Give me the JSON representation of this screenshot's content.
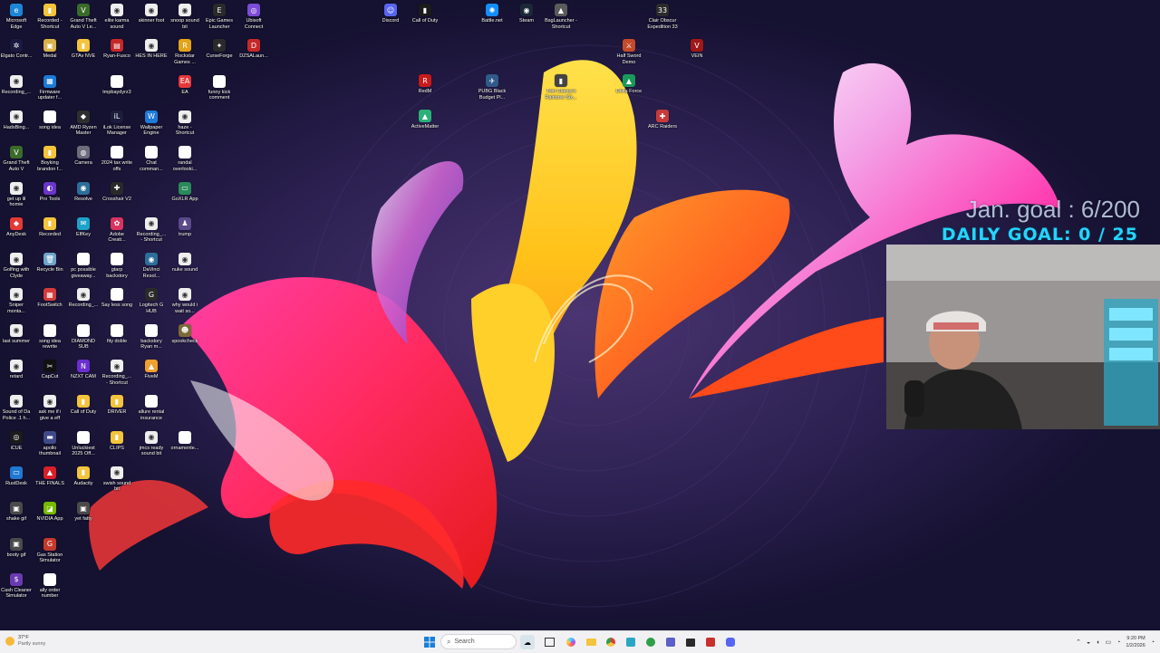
{
  "overlay": {
    "monthly_goal": "Jan. goal : 6/200",
    "daily_goal": "DAILY GOAL: 0 / 25"
  },
  "desktop_icons": [
    {
      "label": "Microsoft Edge",
      "color": "#1c86d6",
      "glyph": "e"
    },
    {
      "label": "Recorded - Shortcut",
      "color": "#f3c43c",
      "glyph": "▮"
    },
    {
      "label": "Grand Theft Auto V Le...",
      "color": "#3a6b2a",
      "glyph": "V"
    },
    {
      "label": "elite karma sound",
      "color": "#eeeeee",
      "glyph": "◉"
    },
    {
      "label": "skinner foot",
      "color": "#eeeeee",
      "glyph": "◉"
    },
    {
      "label": "snoop sound bit",
      "color": "#eeeeee",
      "glyph": "◉"
    },
    {
      "label": "Epic Games Launcher",
      "color": "#2a2a2a",
      "glyph": "E"
    },
    {
      "label": "Ubisoft Connect",
      "color": "#7c4cd6",
      "glyph": "◎"
    },
    {
      "label": "Elgato Contr...",
      "color": "#1a1a40",
      "glyph": "✲"
    },
    {
      "label": "Medal",
      "color": "#d8b24a",
      "glyph": "▣"
    },
    {
      "label": "GTAv NVE",
      "color": "#f3c43c",
      "glyph": "▮"
    },
    {
      "label": "Ryan-Fusco",
      "color": "#c62828",
      "glyph": "▤"
    },
    {
      "label": "HES IN HERE",
      "color": "#eeeeee",
      "glyph": "◉"
    },
    {
      "label": "Rockstar Games ...",
      "color": "#e3a41a",
      "glyph": "R"
    },
    {
      "label": "CurseForge",
      "color": "#2a2a2a",
      "glyph": "✦"
    },
    {
      "label": "DZSALaun...",
      "color": "#c62828",
      "glyph": "D"
    },
    {
      "label": "Recording_...",
      "color": "#eeeeee",
      "glyph": "◉"
    },
    {
      "label": "Firmware updater f...",
      "color": "#1b7bd6",
      "glyph": "▦"
    },
    {
      "label": "",
      "color": "transparent",
      "glyph": ""
    },
    {
      "label": "tmpbaydyrz3",
      "color": "#ffffff",
      "glyph": ""
    },
    {
      "label": "",
      "color": "transparent",
      "glyph": ""
    },
    {
      "label": "EA",
      "color": "#e5383b",
      "glyph": "EA"
    },
    {
      "label": "funny kick comment",
      "color": "#ffffff",
      "glyph": ""
    },
    {
      "label": "",
      "color": "transparent",
      "glyph": ""
    },
    {
      "label": "HadsBing...",
      "color": "#eeeeee",
      "glyph": "◉"
    },
    {
      "label": "song idea",
      "color": "#ffffff",
      "glyph": ""
    },
    {
      "label": "AMD Ryzen Master",
      "color": "#2f2f2f",
      "glyph": "◆"
    },
    {
      "label": "iLok License Manager",
      "color": "#1c1c3c",
      "glyph": "iL"
    },
    {
      "label": "Wallpaper Engine",
      "color": "#1f7ad8",
      "glyph": "W"
    },
    {
      "label": "haze - Shortcut",
      "color": "#eeeeee",
      "glyph": "◉"
    },
    {
      "label": "",
      "color": "transparent",
      "glyph": ""
    },
    {
      "label": "",
      "color": "transparent",
      "glyph": ""
    },
    {
      "label": "Grand Theft Auto V",
      "color": "#3a6b2a",
      "glyph": "V"
    },
    {
      "label": "Boyking brandon f...",
      "color": "#f3c43c",
      "glyph": "▮"
    },
    {
      "label": "Camera",
      "color": "#6c6c7c",
      "glyph": "◍"
    },
    {
      "label": "2024 tax write offs",
      "color": "#ffffff",
      "glyph": ""
    },
    {
      "label": "Chat comman...",
      "color": "#ffffff",
      "glyph": ""
    },
    {
      "label": "randal overlooki...",
      "color": "#ffffff",
      "glyph": ""
    },
    {
      "label": "",
      "color": "transparent",
      "glyph": ""
    },
    {
      "label": "",
      "color": "transparent",
      "glyph": ""
    },
    {
      "label": "get up lil homie",
      "color": "#eeeeee",
      "glyph": "◉"
    },
    {
      "label": "Pro Tools",
      "color": "#6a36c9",
      "glyph": "◐"
    },
    {
      "label": "Resolve",
      "color": "#2c6e99",
      "glyph": "◉"
    },
    {
      "label": "Crosshair V2",
      "color": "#2a2a2a",
      "glyph": "✚"
    },
    {
      "label": "",
      "color": "transparent",
      "glyph": ""
    },
    {
      "label": "GoXLR App",
      "color": "#2a8a5a",
      "glyph": "▭"
    },
    {
      "label": "",
      "color": "transparent",
      "glyph": ""
    },
    {
      "label": "",
      "color": "transparent",
      "glyph": ""
    },
    {
      "label": "AnyDesk",
      "color": "#e53935",
      "glyph": "◆"
    },
    {
      "label": "Recorded",
      "color": "#f3c43c",
      "glyph": "▮"
    },
    {
      "label": "ElfKey",
      "color": "#1ea2c9",
      "glyph": "✉"
    },
    {
      "label": "Adobe Creati...",
      "color": "#d8345f",
      "glyph": "✿"
    },
    {
      "label": "Recording_... - Shortcut",
      "color": "#eeeeee",
      "glyph": "◉"
    },
    {
      "label": "trump",
      "color": "#5a4a8a",
      "glyph": "♟"
    },
    {
      "label": "",
      "color": "transparent",
      "glyph": ""
    },
    {
      "label": "",
      "color": "transparent",
      "glyph": ""
    },
    {
      "label": "Golfing with Clyde",
      "color": "#eeeeee",
      "glyph": "◉"
    },
    {
      "label": "Recycle Bin",
      "color": "#6fa4c9",
      "glyph": "🗑"
    },
    {
      "label": "pc possible giveaway...",
      "color": "#ffffff",
      "glyph": ""
    },
    {
      "label": "gtarp backstory",
      "color": "#ffffff",
      "glyph": ""
    },
    {
      "label": "DaVinci Resol...",
      "color": "#2c6e99",
      "glyph": "◉"
    },
    {
      "label": "nuke sound",
      "color": "#eeeeee",
      "glyph": "◉"
    },
    {
      "label": "",
      "color": "transparent",
      "glyph": ""
    },
    {
      "label": "",
      "color": "transparent",
      "glyph": ""
    },
    {
      "label": "Sniper monta...",
      "color": "#eeeeee",
      "glyph": "◉"
    },
    {
      "label": "FootSwitch",
      "color": "#d33b3b",
      "glyph": "▦"
    },
    {
      "label": "Recording_...",
      "color": "#eeeeee",
      "glyph": "◉"
    },
    {
      "label": "Say less song",
      "color": "#ffffff",
      "glyph": ""
    },
    {
      "label": "Logitech G HUB",
      "color": "#2a2a2a",
      "glyph": "G"
    },
    {
      "label": "why would i wait so...",
      "color": "#eeeeee",
      "glyph": "◉"
    },
    {
      "label": "",
      "color": "transparent",
      "glyph": ""
    },
    {
      "label": "",
      "color": "transparent",
      "glyph": ""
    },
    {
      "label": "last summer",
      "color": "#eeeeee",
      "glyph": "◉"
    },
    {
      "label": "song idea rewrite",
      "color": "#ffffff",
      "glyph": ""
    },
    {
      "label": "DIAMOND SUB",
      "color": "#ffffff",
      "glyph": ""
    },
    {
      "label": "fity doble",
      "color": "#ffffff",
      "glyph": ""
    },
    {
      "label": "backstory Ryan m...",
      "color": "#ffffff",
      "glyph": ""
    },
    {
      "label": "spookcheck",
      "color": "#7a6a3a",
      "glyph": "☻"
    },
    {
      "label": "",
      "color": "transparent",
      "glyph": ""
    },
    {
      "label": "",
      "color": "transparent",
      "glyph": ""
    },
    {
      "label": "retard",
      "color": "#eeeeee",
      "glyph": "◉"
    },
    {
      "label": "CapCut",
      "color": "#111111",
      "glyph": "✂"
    },
    {
      "label": "NZXT CAM",
      "color": "#6a2fcf",
      "glyph": "N"
    },
    {
      "label": "Recording_... - Shortcut",
      "color": "#eeeeee",
      "glyph": "◉"
    },
    {
      "label": "FiveM",
      "color": "#f0a030",
      "glyph": "▲"
    },
    {
      "label": "",
      "color": "transparent",
      "glyph": ""
    },
    {
      "label": "",
      "color": "transparent",
      "glyph": ""
    },
    {
      "label": "",
      "color": "transparent",
      "glyph": ""
    },
    {
      "label": "Sound of Da Police .1 h...",
      "color": "#eeeeee",
      "glyph": "◉"
    },
    {
      "label": "ask me if i give a eff",
      "color": "#eeeeee",
      "glyph": "◉"
    },
    {
      "label": "Call of Duty",
      "color": "#f3c43c",
      "glyph": "▮"
    },
    {
      "label": "DRIVER",
      "color": "#f3c43c",
      "glyph": "▮"
    },
    {
      "label": "allure rental insurance",
      "color": "#ffffff",
      "glyph": ""
    },
    {
      "label": "",
      "color": "transparent",
      "glyph": ""
    },
    {
      "label": "",
      "color": "transparent",
      "glyph": ""
    },
    {
      "label": "",
      "color": "transparent",
      "glyph": ""
    },
    {
      "label": "iCUE",
      "color": "#1b1b1b",
      "glyph": "◎"
    },
    {
      "label": "apollo thumbnail",
      "color": "#3f4a8a",
      "glyph": "▬"
    },
    {
      "label": "Unluckiest 2025 Off...",
      "color": "#ffffff",
      "glyph": ""
    },
    {
      "label": "CLIPS",
      "color": "#f3c43c",
      "glyph": "▮"
    },
    {
      "label": "jmcs ready sound bit",
      "color": "#eeeeee",
      "glyph": "◉"
    },
    {
      "label": "ornamente...",
      "color": "#ffffff",
      "glyph": ""
    },
    {
      "label": "",
      "color": "transparent",
      "glyph": ""
    },
    {
      "label": "",
      "color": "transparent",
      "glyph": ""
    },
    {
      "label": "RustDesk",
      "color": "#1f78d1",
      "glyph": "▭"
    },
    {
      "label": "THE FINALS",
      "color": "#d81f2a",
      "glyph": "▲"
    },
    {
      "label": "Audacity",
      "color": "#f3c43c",
      "glyph": "▮"
    },
    {
      "label": "swish sound bit",
      "color": "#eeeeee",
      "glyph": "◉"
    },
    {
      "label": "",
      "color": "transparent",
      "glyph": ""
    },
    {
      "label": "",
      "color": "transparent",
      "glyph": ""
    },
    {
      "label": "",
      "color": "transparent",
      "glyph": ""
    },
    {
      "label": "",
      "color": "transparent",
      "glyph": ""
    },
    {
      "label": "shake gif",
      "color": "#4a4a4a",
      "glyph": "▣"
    },
    {
      "label": "NVIDIA App",
      "color": "#76b900",
      "glyph": "◪"
    },
    {
      "label": "yet fatty",
      "color": "#4a4a4a",
      "glyph": "▣"
    },
    {
      "label": "",
      "color": "transparent",
      "glyph": ""
    },
    {
      "label": "",
      "color": "transparent",
      "glyph": ""
    },
    {
      "label": "",
      "color": "transparent",
      "glyph": ""
    },
    {
      "label": "",
      "color": "transparent",
      "glyph": ""
    },
    {
      "label": "",
      "color": "transparent",
      "glyph": ""
    },
    {
      "label": "booty gif",
      "color": "#4a4a4a",
      "glyph": "▣"
    },
    {
      "label": "Gas Station Simulator",
      "color": "#c43a2a",
      "glyph": "G"
    },
    {
      "label": "",
      "color": "transparent",
      "glyph": ""
    },
    {
      "label": "",
      "color": "transparent",
      "glyph": ""
    },
    {
      "label": "",
      "color": "transparent",
      "glyph": ""
    },
    {
      "label": "",
      "color": "transparent",
      "glyph": ""
    },
    {
      "label": "",
      "color": "transparent",
      "glyph": ""
    },
    {
      "label": "",
      "color": "transparent",
      "glyph": ""
    },
    {
      "label": "Cash Cleaner Simulator",
      "color": "#6a3ab0",
      "glyph": "$"
    },
    {
      "label": "ally order number",
      "color": "#ffffff",
      "glyph": ""
    },
    {
      "label": "",
      "color": "transparent",
      "glyph": ""
    },
    {
      "label": "",
      "color": "transparent",
      "glyph": ""
    },
    {
      "label": "",
      "color": "transparent",
      "glyph": ""
    },
    {
      "label": "",
      "color": "transparent",
      "glyph": ""
    },
    {
      "label": "",
      "color": "transparent",
      "glyph": ""
    },
    {
      "label": "",
      "color": "transparent",
      "glyph": ""
    }
  ],
  "top_icons": [
    {
      "label": "Discord",
      "color": "#5865f2",
      "glyph": "☺"
    },
    {
      "label": "Call of Duty",
      "color": "#1b1b1b",
      "glyph": "▮"
    },
    {
      "label": "Battle.net",
      "color": "#148eff",
      "glyph": "✺"
    },
    {
      "label": "Steam",
      "color": "#1b2838",
      "glyph": "◉"
    },
    {
      "label": "BsgLauncher - Shortcut",
      "color": "#5b5b5b",
      "glyph": "▲"
    },
    {
      "label": "Clair Obscur Expedition 33",
      "color": "#2b2b2b",
      "glyph": "33"
    },
    {
      "label": "Half Sword Demo",
      "color": "#c44a2a",
      "glyph": "⚔"
    },
    {
      "label": "VEIN",
      "color": "#a01818",
      "glyph": "V"
    },
    {
      "label": "RedM",
      "color": "#c81a1a",
      "glyph": "R"
    },
    {
      "label": "PUBG Black Budget Pl...",
      "color": "#2f5a8a",
      "glyph": "✈"
    },
    {
      "label": "Tom Clancy's Rainbow Six...",
      "color": "#444444",
      "glyph": "▮"
    },
    {
      "label": "Delta Force",
      "color": "#1a9a5a",
      "glyph": "▲"
    },
    {
      "label": "ActiveMatter",
      "color": "#2bb07a",
      "glyph": "▲"
    },
    {
      "label": "ARC Raiders",
      "color": "#c93a3a",
      "glyph": "✚"
    }
  ],
  "taskbar": {
    "search_placeholder": "Search",
    "weather_temp": "37°F",
    "weather_desc": "Partly sunny",
    "time": "9:20 PM",
    "date": "1/2/2026"
  }
}
